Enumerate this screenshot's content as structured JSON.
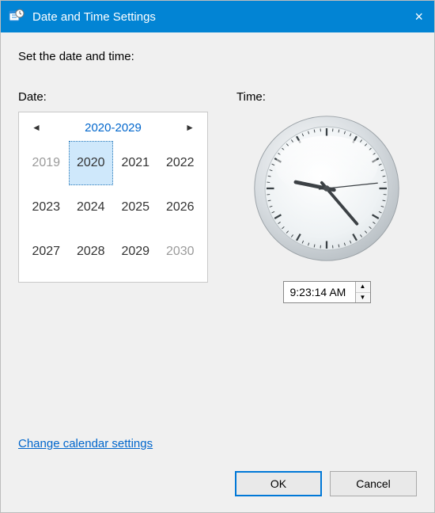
{
  "window": {
    "title": "Date and Time Settings",
    "close_icon": "×"
  },
  "instruction": "Set the date and time:",
  "labels": {
    "date": "Date:",
    "time": "Time:"
  },
  "calendar": {
    "range_label": "2020-2029",
    "prev_icon": "◄",
    "next_icon": "►",
    "years": [
      {
        "value": "2019",
        "outside": true,
        "selected": false
      },
      {
        "value": "2020",
        "outside": false,
        "selected": true
      },
      {
        "value": "2021",
        "outside": false,
        "selected": false
      },
      {
        "value": "2022",
        "outside": false,
        "selected": false
      },
      {
        "value": "2023",
        "outside": false,
        "selected": false
      },
      {
        "value": "2024",
        "outside": false,
        "selected": false
      },
      {
        "value": "2025",
        "outside": false,
        "selected": false
      },
      {
        "value": "2026",
        "outside": false,
        "selected": false
      },
      {
        "value": "2027",
        "outside": false,
        "selected": false
      },
      {
        "value": "2028",
        "outside": false,
        "selected": false
      },
      {
        "value": "2029",
        "outside": false,
        "selected": false
      },
      {
        "value": "2030",
        "outside": true,
        "selected": false
      }
    ]
  },
  "clock": {
    "hours": 9,
    "minutes": 23,
    "seconds": 14,
    "period": "AM"
  },
  "time_input": {
    "value": "9:23:14 AM",
    "up_icon": "▲",
    "down_icon": "▼"
  },
  "link": {
    "label": "Change calendar settings"
  },
  "buttons": {
    "ok": "OK",
    "cancel": "Cancel"
  }
}
